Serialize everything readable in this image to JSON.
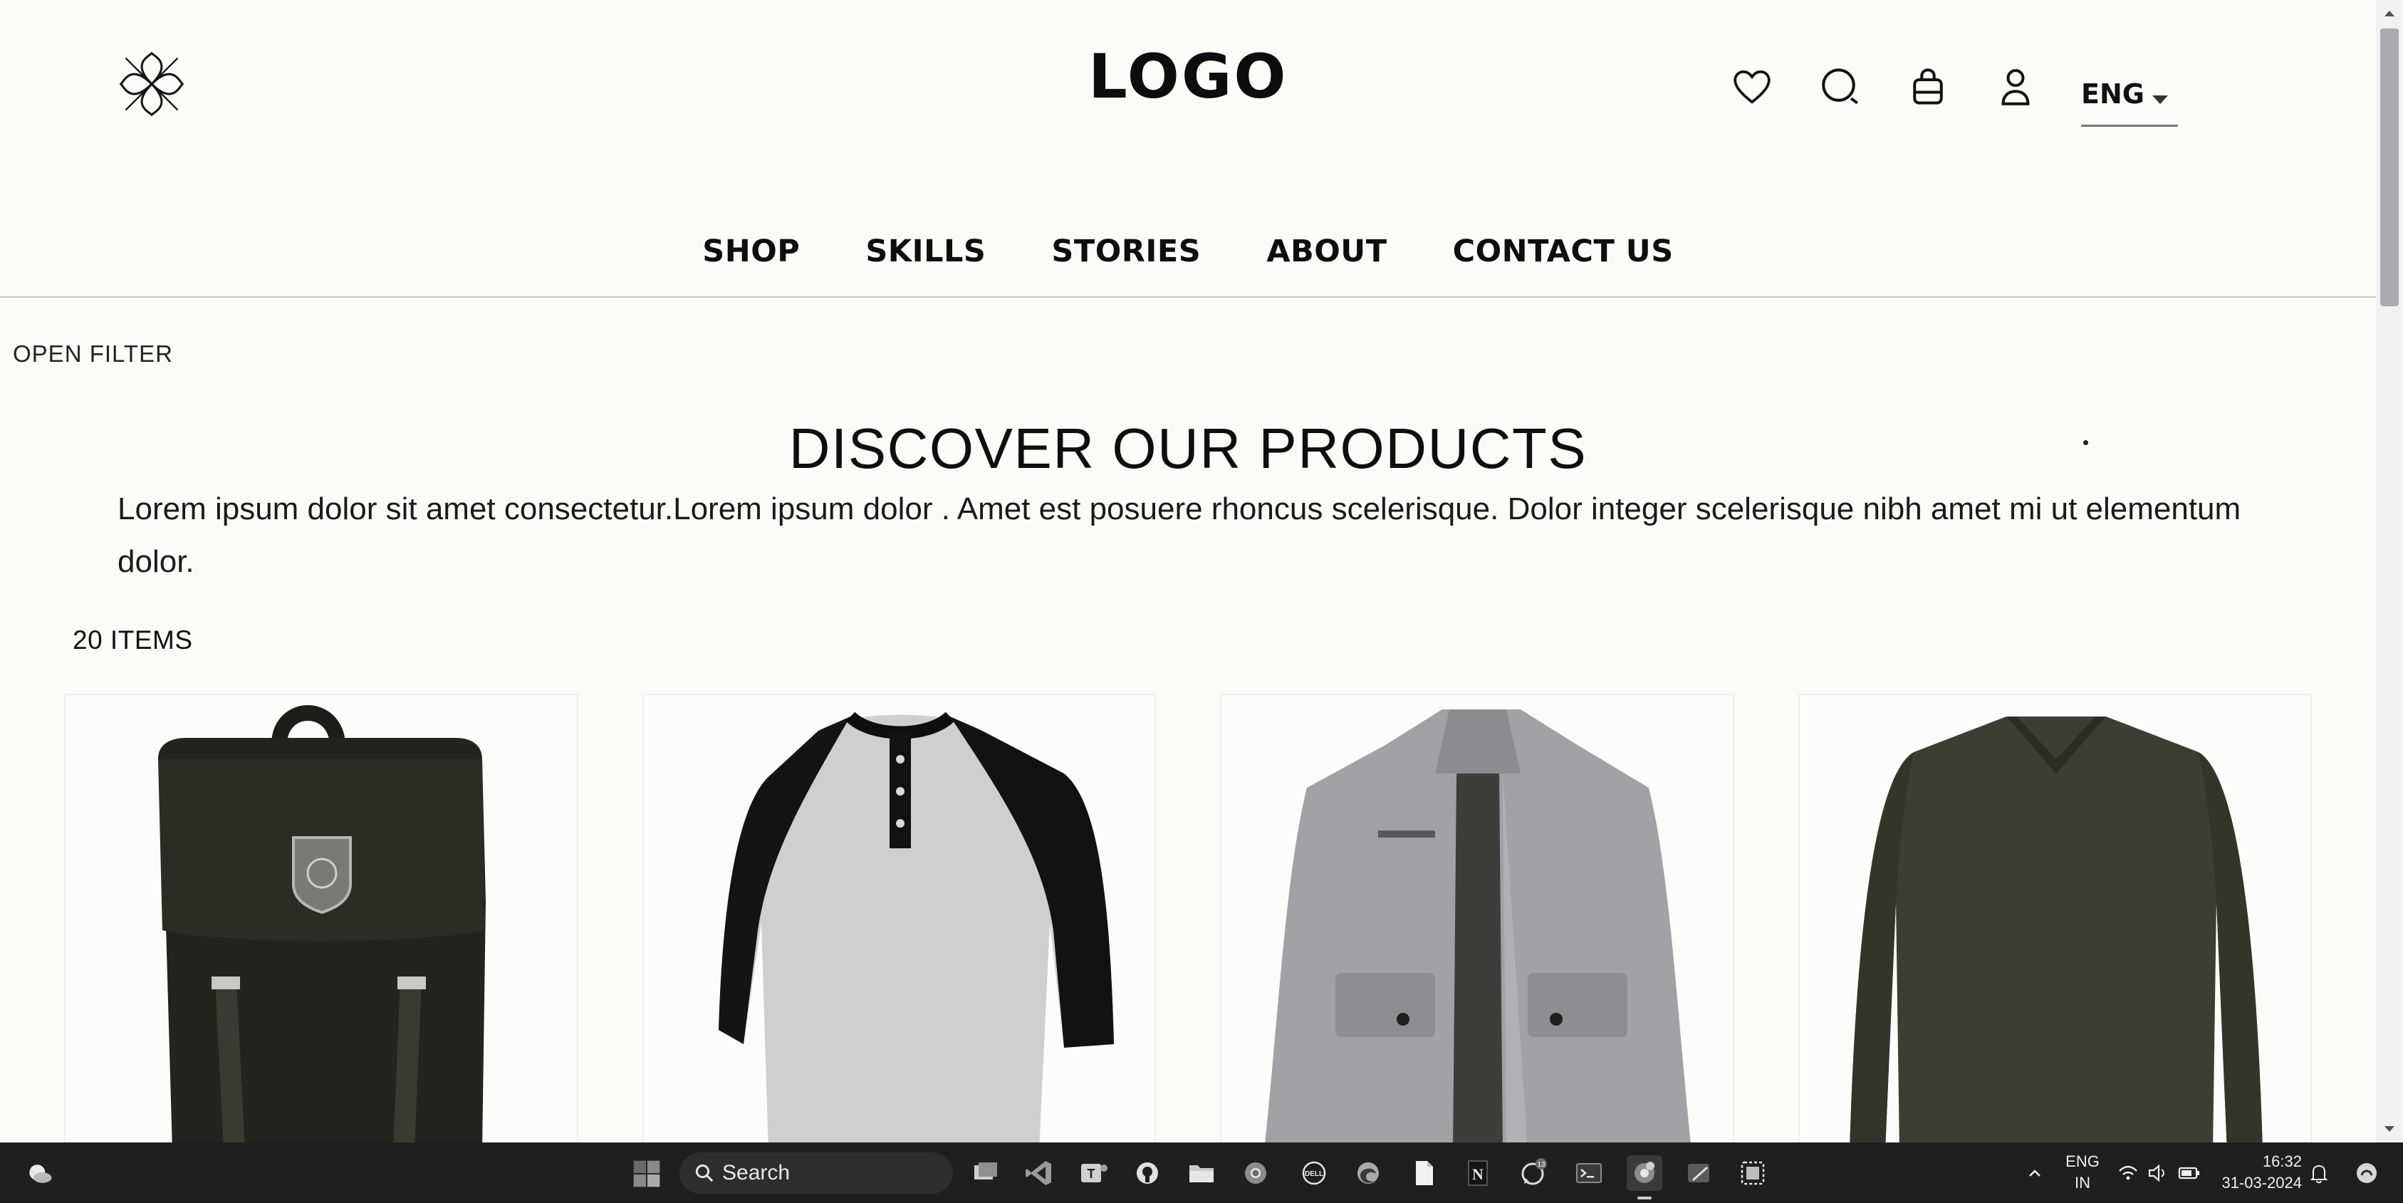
{
  "header": {
    "logo_text": "LOGO",
    "brand_mark_icon": "clover-knot-icon",
    "icons": [
      "heart-icon",
      "search-icon",
      "shopping-bag-icon",
      "user-icon"
    ],
    "language": "ENG"
  },
  "nav": {
    "items": [
      "SHOP",
      "SKILLS",
      "STORIES",
      "ABOUT",
      "CONTACT US"
    ]
  },
  "main": {
    "open_filter": "OPEN FILTER",
    "title": "DISCOVER OUR PRODUCTS",
    "intro": "Lorem ipsum dolor sit amet consectetur.Lorem ipsum dolor . Amet est posuere rhoncus scelerisque. Dolor integer scelerisque nibh amet mi ut elementum dolor.",
    "item_count": "20 ITEMS",
    "products": [
      {
        "image": "dark-backpack"
      },
      {
        "image": "raglan-henley-tshirt"
      },
      {
        "image": "grey-field-jacket"
      },
      {
        "image": "olive-vneck-longsleeve"
      }
    ]
  },
  "taskbar": {
    "search_placeholder": "Search",
    "apps": [
      "task-view",
      "vscode",
      "teams",
      "github",
      "file-explorer",
      "chrome",
      "dell",
      "edge",
      "notepad",
      "notion",
      "whatsapp",
      "terminal",
      "chrome-profile",
      "paint",
      "snipping-tool"
    ],
    "whatsapp_badge": "13",
    "lang_line1": "ENG",
    "lang_line2": "IN",
    "time": "16:32",
    "date": "31-03-2024"
  }
}
